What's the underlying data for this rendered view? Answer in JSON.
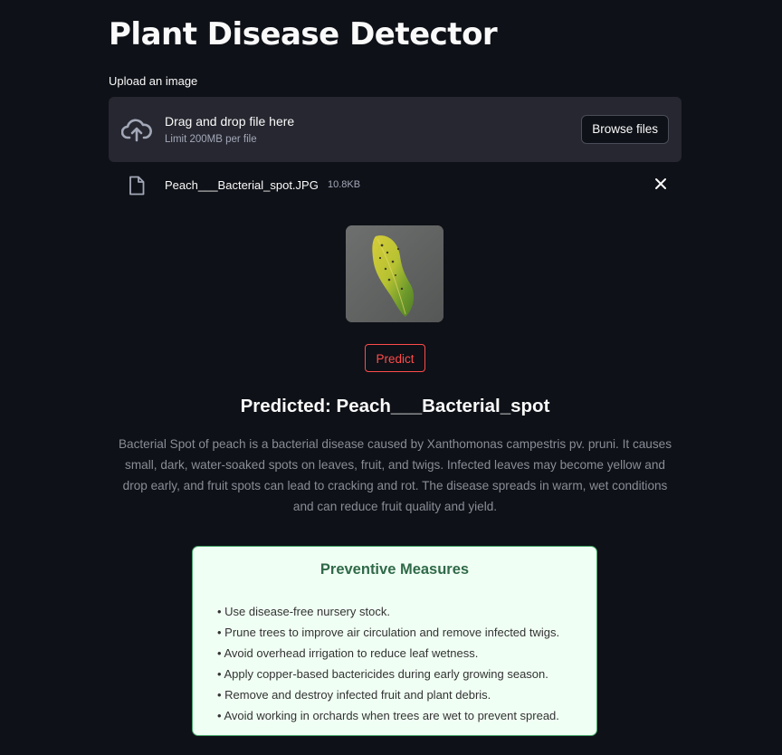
{
  "app": {
    "title": "Plant Disease Detector"
  },
  "uploader": {
    "label": "Upload an image",
    "drop_text": "Drag and drop file here",
    "limit_text": "Limit 200MB per file",
    "browse_label": "Browse files",
    "icon": "cloud-upload-icon"
  },
  "file": {
    "name": "Peach___Bacterial_spot.JPG",
    "size": "10.8KB",
    "icon": "file-icon",
    "remove_icon": "close-icon"
  },
  "preview": {
    "image": "leaf-image"
  },
  "predict_button": {
    "label": "Predict",
    "color": "#ff4b4b"
  },
  "result": {
    "predicted": "Predicted: Peach___Bacterial_spot",
    "description": "Bacterial Spot of peach is a bacterial disease caused by Xanthomonas campestris pv. pruni. It causes small, dark, water-soaked spots on leaves, fruit, and twigs. Infected leaves may become yellow and drop early, and fruit spots can lead to cracking and rot. The disease spreads in warm, wet conditions and can reduce fruit quality and yield."
  },
  "preventive": {
    "title": "Preventive Measures",
    "items": [
      "• Use disease-free nursery stock.",
      "• Prune trees to improve air circulation and remove infected twigs.",
      "• Avoid overhead irrigation to reduce leaf wetness.",
      "• Apply copper-based bactericides during early growing season.",
      "• Remove and destroy infected fruit and plant debris.",
      "• Avoid working in orchards when trees are wet to prevent spread."
    ],
    "background": "#f0fff4",
    "accent": "#2f6a48"
  },
  "theme": {
    "background": "#0e1117",
    "panel": "#262730"
  }
}
